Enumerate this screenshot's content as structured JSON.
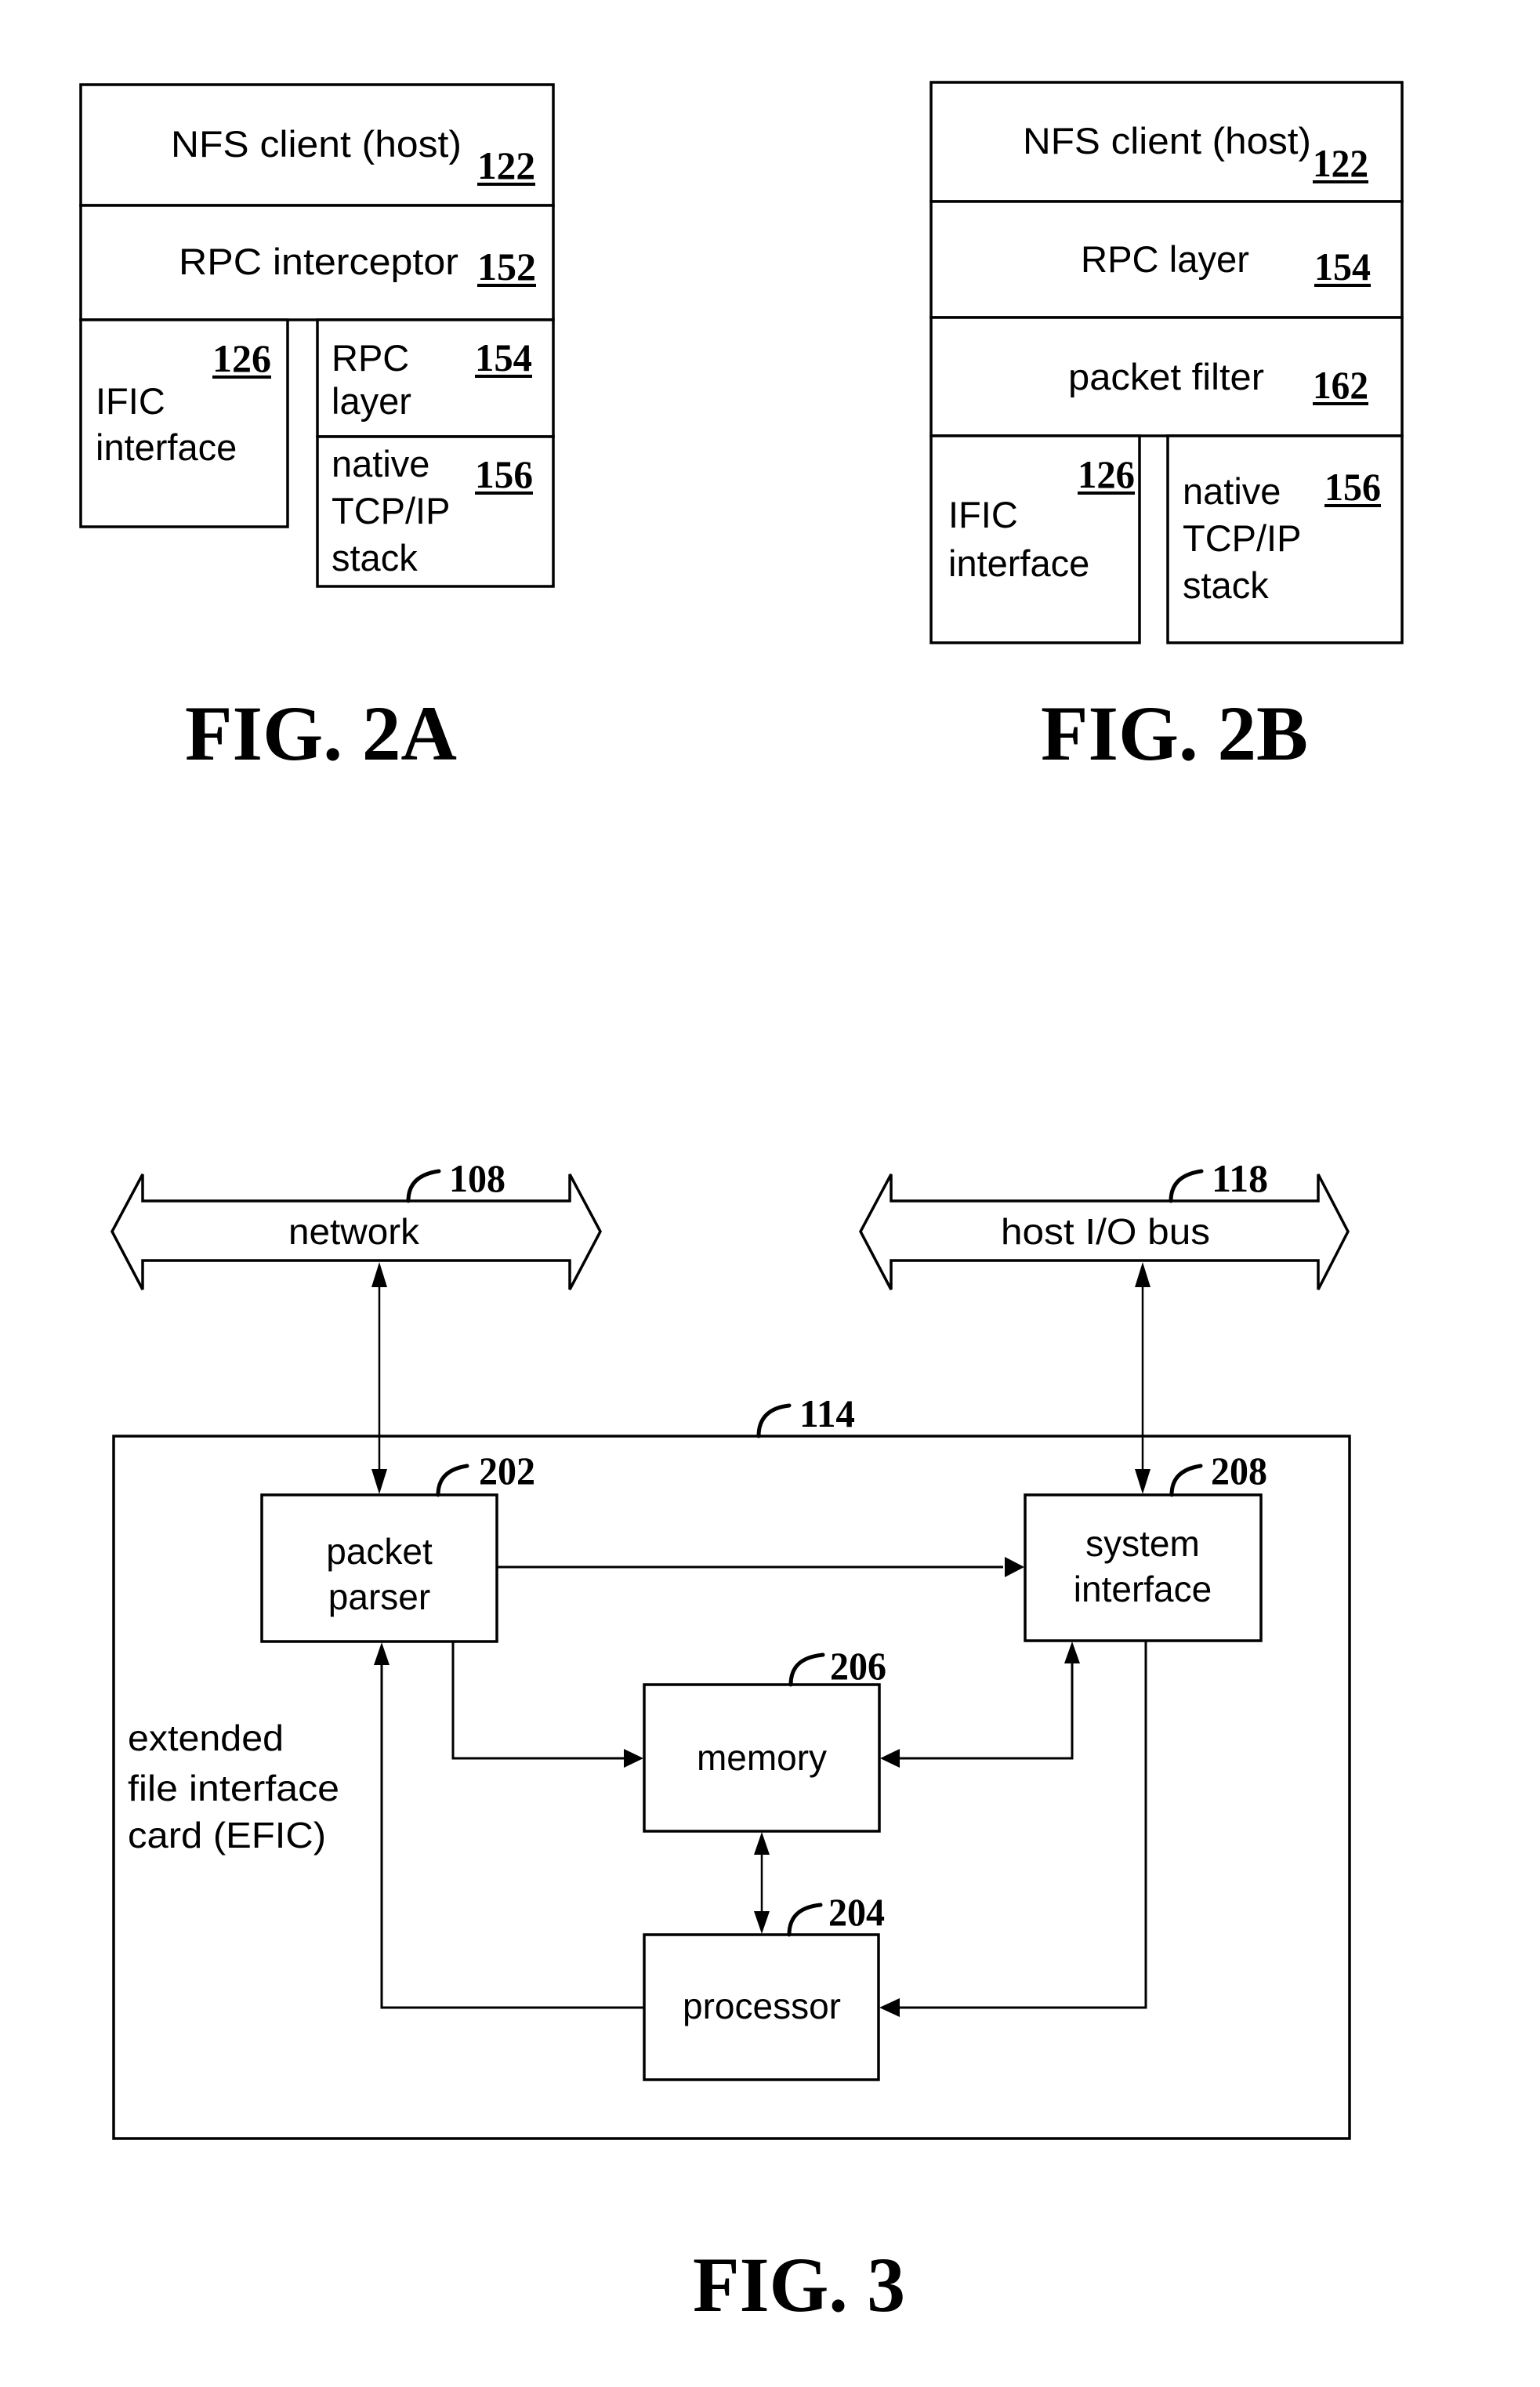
{
  "fig2a": {
    "caption": "FIG. 2A",
    "nfs_client": {
      "label": "NFS client (host)",
      "ref": "122"
    },
    "rpc_interceptor": {
      "label": "RPC interceptor",
      "ref": "152"
    },
    "ific_interface": {
      "lines": [
        "IFIC",
        "interface"
      ],
      "ref": "126"
    },
    "rpc_layer": {
      "lines": [
        "RPC",
        "layer"
      ],
      "ref": "154"
    },
    "native_stack": {
      "lines": [
        "native",
        "TCP/IP",
        "stack"
      ],
      "ref": "156"
    }
  },
  "fig2b": {
    "caption": "FIG. 2B",
    "nfs_client": {
      "label": "NFS client (host)",
      "ref": "122"
    },
    "rpc_layer": {
      "label": "RPC layer",
      "ref": "154"
    },
    "packet_filter": {
      "label": "packet filter",
      "ref": "162"
    },
    "ific_interface": {
      "lines": [
        "IFIC",
        "interface"
      ],
      "ref": "126"
    },
    "native_stack": {
      "lines": [
        "native",
        "TCP/IP",
        "stack"
      ],
      "ref": "156"
    }
  },
  "fig3": {
    "caption": "FIG. 3",
    "network": {
      "label": "network",
      "ref": "108"
    },
    "host_io_bus": {
      "label": "host I/O bus",
      "ref": "118"
    },
    "efic": {
      "lines": [
        "extended",
        "file interface",
        "card (EFIC)"
      ],
      "ref": "114"
    },
    "packet_parser": {
      "lines": [
        "packet",
        "parser"
      ],
      "ref": "202"
    },
    "system_interface": {
      "lines": [
        "system",
        "interface"
      ],
      "ref": "208"
    },
    "memory": {
      "label": "memory",
      "ref": "206"
    },
    "processor": {
      "label": "processor",
      "ref": "204"
    }
  }
}
